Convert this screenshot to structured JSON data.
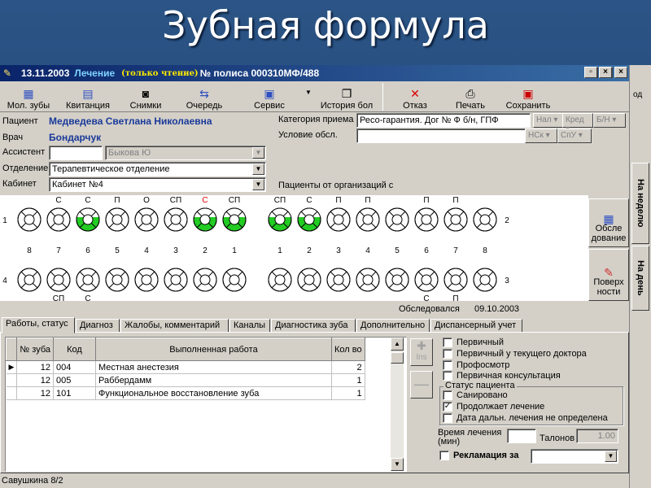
{
  "slide_title": "Зубная формула",
  "window": {
    "date": "13.11.2003",
    "mode": "Лечение",
    "readonly": "(только чтение)",
    "policy": "№ полиса 000310МФ/488"
  },
  "right_strip": {
    "label": "од",
    "tab_week": "На неделю",
    "tab_day": "На день"
  },
  "toolbar": [
    {
      "label": "Мол. зубы",
      "icon": "teeth-icon"
    },
    {
      "label": "Квитанция",
      "icon": "receipt-icon"
    },
    {
      "label": "Снимки",
      "icon": "camera-icon"
    },
    {
      "label": "Очередь",
      "icon": "queue-icon"
    },
    {
      "label": "Сервис",
      "icon": "service-icon"
    },
    {
      "label": "История бол",
      "icon": "history-icon"
    },
    {
      "label": "Отказ",
      "icon": "close-icon"
    },
    {
      "label": "Печать",
      "icon": "print-icon"
    },
    {
      "label": "Сохранить",
      "icon": "save-icon"
    }
  ],
  "form": {
    "patient_label": "Пациент",
    "patient": "Медведева Светлана Николаевна",
    "doctor_label": "Врач",
    "doctor": "Бондарчук",
    "assistant_label": "Ассистент",
    "assistant_value": "Быкова Ю",
    "dept_label": "Отделение",
    "dept": "Терапевтическое отделение",
    "cabinet_label": "Кабинет",
    "cabinet": "Кабинет №4",
    "category_label": "Категория приема",
    "category": "Ресо-гарантия. Дог № Ф б/н, ГПФ",
    "condition_label": "Условие обсл.",
    "orgs_label": "Пациенты от организаций с",
    "btn_nal": "Нал",
    "btn_kred": "Кред",
    "btn_bn": "Б/Н",
    "btn_nsk": "НСк",
    "btn_spu": "СпУ"
  },
  "chart_data": {
    "type": "table",
    "upper_left": {
      "numbers": [
        "8",
        "7",
        "6",
        "5",
        "4",
        "3",
        "2",
        "1"
      ],
      "marks": [
        "",
        "С",
        "С",
        "П",
        "О",
        "СП",
        "С",
        "СП"
      ],
      "treated": [
        false,
        false,
        true,
        false,
        false,
        false,
        true,
        true
      ]
    },
    "upper_right": {
      "numbers": [
        "1",
        "2",
        "3",
        "4",
        "5",
        "6",
        "7",
        "8"
      ],
      "marks": [
        "СП",
        "С",
        "П",
        "П",
        "",
        "П",
        "П",
        ""
      ],
      "treated": [
        true,
        true,
        false,
        false,
        false,
        false,
        false,
        false
      ]
    },
    "lower_left": {
      "marks": [
        "",
        "СП",
        "С",
        "",
        "",
        "",
        "",
        ""
      ]
    },
    "lower_right": {
      "marks": [
        "",
        "",
        "",
        "",
        "",
        "С",
        "П",
        ""
      ]
    },
    "quadrants": {
      "q1": "1",
      "q2": "2",
      "q3": "3",
      "q4": "4"
    },
    "colors": {
      "treated": "#22cc22",
      "highlight_mark": "#dd0000"
    }
  },
  "side": {
    "exam": "Обсле дование",
    "surfaces": "Поверх ности"
  },
  "status": {
    "examined_label": "Обследовался",
    "examined_date": "09.10.2003"
  },
  "tabs": [
    "Работы, статус",
    "Диагноз",
    "Жалобы, комментарий",
    "Каналы",
    "Диагностика зуба",
    "Дополнительно",
    "Диспансерный учет"
  ],
  "works": {
    "headers": [
      "№ зуба",
      "Код",
      "Выполненная работа",
      "Кол во"
    ],
    "rows": [
      [
        "12",
        "004",
        "Местная анестезия",
        "2"
      ],
      [
        "12",
        "005",
        "Раббердамм",
        "1"
      ],
      [
        "12",
        "101",
        "Функциональное восстановление зуба",
        "1"
      ]
    ]
  },
  "ins_label": "Ins",
  "checks": {
    "primary": "Первичный",
    "primary_doctor": "Первичный у текущего доктора",
    "prophylaxis": "Профосмотр",
    "primary_consult": "Первичная консультация",
    "status_title": "Статус пациента",
    "sanitized": "Санировано",
    "continues": "Продолжает лечение",
    "undefined_date": "Дата дальн. лечения не определена",
    "continues_checked": true
  },
  "treatment": {
    "time_label": "Время лечения (мин)",
    "talons_label": "Талонов",
    "talons_value": "1.00",
    "reclaim_label": "Рекламация за"
  },
  "bottom": "Савушкина 8/2"
}
